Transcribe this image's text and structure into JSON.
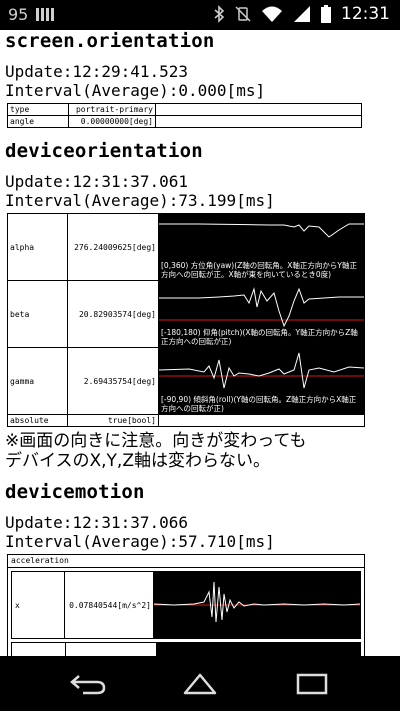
{
  "status_bar": {
    "notification_count": "95",
    "time": "12:31",
    "icons": [
      "bluetooth-icon",
      "vibrate-off-icon",
      "wifi-icon",
      "signal-icon",
      "battery-icon"
    ]
  },
  "screen_orientation": {
    "heading": "screen.orientation",
    "update": "Update:12:29:41.523",
    "interval": "Interval(Average):0.000[ms]",
    "rows": [
      {
        "label": "type",
        "value": "portrait-primary"
      },
      {
        "label": "angle",
        "value": "0.00000000[deg]"
      }
    ]
  },
  "deviceorientation": {
    "heading": "deviceorientation",
    "update": "Update:12:31:37.061",
    "interval": "Interval(Average):73.199[ms]",
    "rows": [
      {
        "label": "alpha",
        "value": "276.24009625[deg]",
        "note": "[0,360) 方位角(yaw)(Z軸の回転角。X軸正方向からY軸正方向への回転が正。X軸が東を向いているとき0度)"
      },
      {
        "label": "beta",
        "value": "20.82903574[deg]",
        "note": "[-180,180) 仰角(pitch)(X軸の回転角。Y軸正方向からZ軸正方向への回転が正)"
      },
      {
        "label": "gamma",
        "value": "2.69435754[deg]",
        "note": "[-90,90) 傾斜角(roll)(Y軸の回転角。Z軸正方向からX軸正方向への回転が正)"
      }
    ],
    "absolute": {
      "label": "absolute",
      "value": "true[bool]"
    }
  },
  "note": {
    "line1": "※画面の向きに注意。向きが変わっても",
    "line2": "デバイスのX,Y,Z軸は変わらない。"
  },
  "devicemotion": {
    "heading": "devicemotion",
    "update": "Update:12:31:37.066",
    "interval": "Interval(Average):57.710[ms]",
    "acceleration": {
      "title": "acceleration",
      "rows": [
        {
          "label": "x",
          "value": "0.07840544[m/s^2]"
        }
      ]
    }
  },
  "navigation": {
    "buttons": [
      "back-button",
      "home-button",
      "recents-button"
    ]
  },
  "colors": {
    "graph_bg": "#000000",
    "graph_line": "#ffffff",
    "graph_baseline": "#d01818"
  }
}
